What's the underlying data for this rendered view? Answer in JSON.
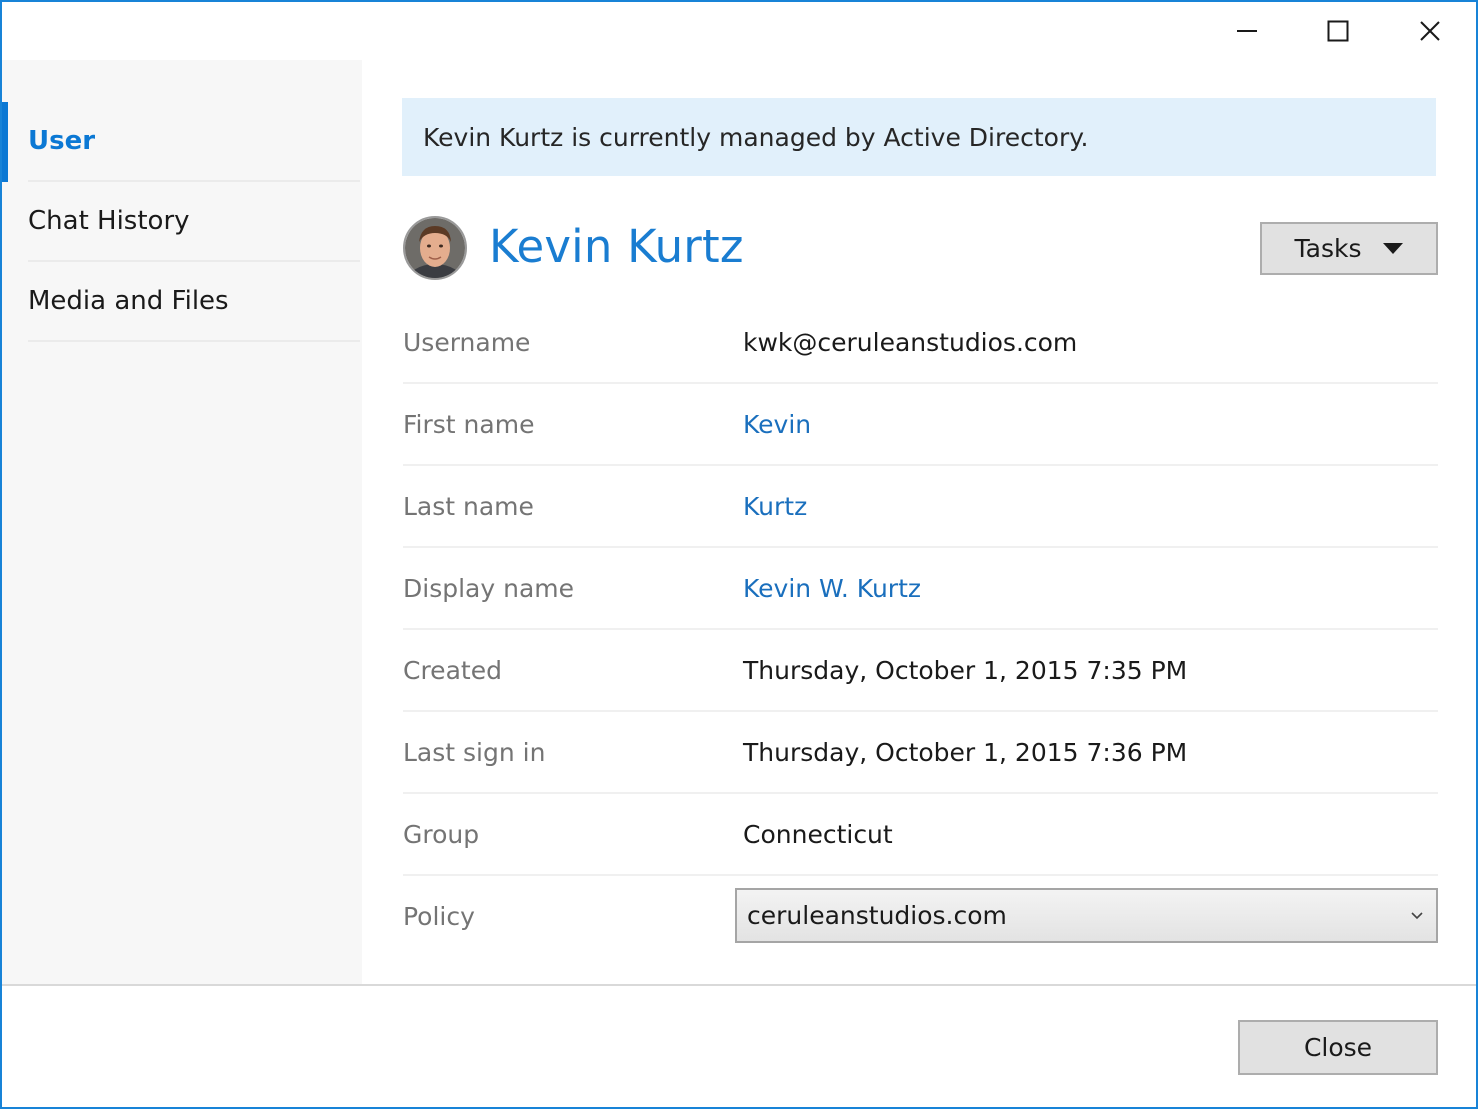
{
  "window": {
    "accent_color": "#1883d7",
    "controls": {
      "minimize": "minimize-icon",
      "maximize": "maximize-icon",
      "close": "close-icon"
    }
  },
  "sidebar": {
    "items": [
      {
        "label": "User",
        "active": true
      },
      {
        "label": "Chat History",
        "active": false
      },
      {
        "label": "Media and Files",
        "active": false
      }
    ]
  },
  "banner": {
    "text": "Kevin Kurtz is currently managed by Active Directory."
  },
  "user": {
    "name": "Kevin Kurtz"
  },
  "tasks_button": {
    "label": "Tasks"
  },
  "fields": [
    {
      "label": "Username",
      "value": "kwk@ceruleanstudios.com"
    },
    {
      "label": "First name",
      "value": "Kevin"
    },
    {
      "label": "Last name",
      "value": "Kurtz"
    },
    {
      "label": "Display name",
      "value": "Kevin W. Kurtz"
    },
    {
      "label": "Created",
      "value": "Thursday, October 1, 2015 7:35 PM"
    },
    {
      "label": "Last sign in",
      "value": "Thursday, October 1, 2015 7:36 PM"
    },
    {
      "label": "Group",
      "value": "Connecticut"
    },
    {
      "label": "Policy",
      "value": "ceruleanstudios.com"
    }
  ],
  "footer": {
    "close_label": "Close"
  }
}
